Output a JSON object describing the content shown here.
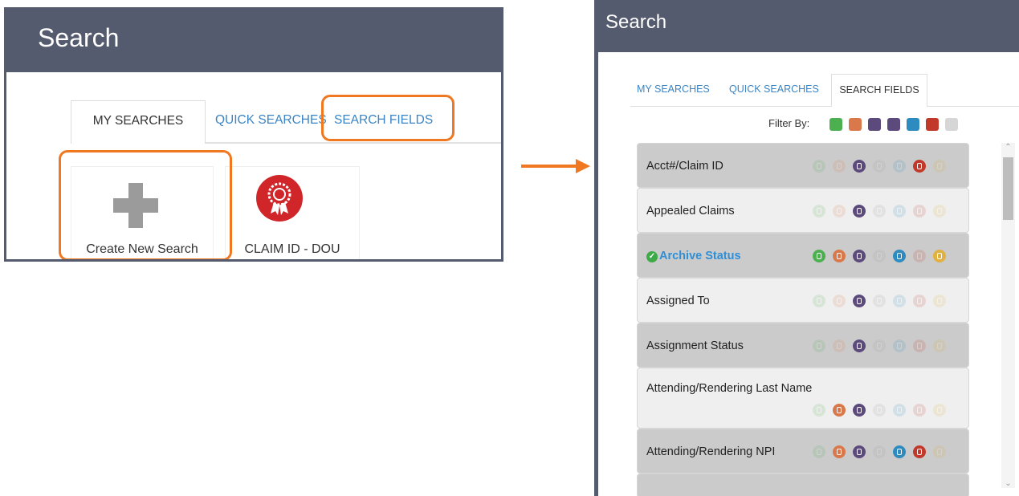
{
  "colors": {
    "header_bg": "#555b6e",
    "highlight_orange": "#f07820",
    "link_blue": "#3a84c5"
  },
  "left": {
    "title": "Search",
    "tabs": [
      "MY SEARCHES",
      "QUICK SEARCHES",
      "SEARCH FIELDS"
    ],
    "active_tab": "MY SEARCHES",
    "tiles": [
      {
        "label": "Create New Search",
        "icon": "plus-icon"
      },
      {
        "label": "CLAIM ID - DOU",
        "icon": "award-ribbon-icon"
      }
    ]
  },
  "right": {
    "title": "Search",
    "tabs": [
      "MY SEARCHES",
      "QUICK SEARCHES",
      "SEARCH FIELDS"
    ],
    "active_tab": "SEARCH FIELDS",
    "filter_label": "Filter By:",
    "filter_icons": [
      {
        "name": "check-icon",
        "color": "#4caf50"
      },
      {
        "name": "folder-icon",
        "color": "#d9784a"
      },
      {
        "name": "document-icon",
        "color": "#5c4a7d"
      },
      {
        "name": "clipboard-icon",
        "color": "#5c4a7d"
      },
      {
        "name": "folder-blue-icon",
        "color": "#2e8bc0"
      },
      {
        "name": "dollar-icon",
        "color": "#c0392b"
      },
      {
        "name": "check-light-icon",
        "color": "#d6d6d6"
      }
    ],
    "fields": [
      {
        "label": "Acct#/Claim ID",
        "active": [
          false,
          false,
          true,
          false,
          false,
          true,
          false
        ]
      },
      {
        "label": "Appealed Claims",
        "active": [
          false,
          false,
          true,
          false,
          false,
          false,
          false
        ]
      },
      {
        "label": "Archive Status",
        "selected": true,
        "active": [
          true,
          true,
          true,
          false,
          true,
          false,
          true
        ]
      },
      {
        "label": "Assigned To",
        "active": [
          false,
          false,
          true,
          false,
          false,
          false,
          false
        ]
      },
      {
        "label": "Assignment Status",
        "active": [
          false,
          false,
          true,
          false,
          false,
          false,
          false
        ]
      },
      {
        "label": "Attending/Rendering Last Name",
        "active": [
          false,
          true,
          true,
          false,
          false,
          false,
          false
        ]
      },
      {
        "label": "Attending/Rendering NPI",
        "active": [
          false,
          true,
          true,
          false,
          true,
          true,
          false
        ]
      }
    ],
    "field_icon_colors": [
      "#4caf50",
      "#d9784a",
      "#5c4a7d",
      "#9e9e9e",
      "#2e8bc0",
      "#c0392b",
      "#e0b040"
    ]
  }
}
